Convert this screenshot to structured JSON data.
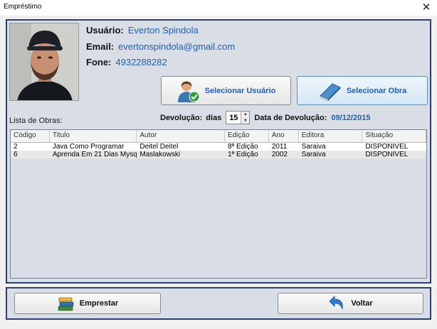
{
  "window": {
    "title": "Empréstimo",
    "close_glyph": "✕"
  },
  "user": {
    "usuario_label": "Usuário:",
    "usuario_value": "Everton Spindola",
    "email_label": "Email:",
    "email_value": "evertonspindola@gmail.com",
    "fone_label": "Fone:",
    "fone_value": "4932288282"
  },
  "buttons": {
    "selecionar_usuario": "Selecionar Usuário",
    "selecionar_obra": "Selecionar Obra",
    "emprestar": "Emprestar",
    "voltar": "Voltar"
  },
  "lista_label": "Lista de Obras:",
  "devolucao": {
    "label": "Devolução:",
    "dias_label": "dias",
    "dias_value": "15",
    "data_label": "Data de Devolução:",
    "data_value": "09/12/2015"
  },
  "table": {
    "columns": [
      "Código",
      "Titulo",
      "Autor",
      "Edição",
      "Ano",
      "Editora",
      "Situação"
    ],
    "rows": [
      [
        "2",
        "Java Como Programar",
        "Deitel Deitel",
        "8ª Edição",
        "2011",
        "Saraiva",
        "DISPONIVEL"
      ],
      [
        "6",
        "Aprenda Em 21 Dias Mysql",
        "Maslakowski",
        "1ª Edição",
        "2002",
        "Saraiva",
        "DISPONIVEL"
      ]
    ]
  },
  "icons": {
    "close": "close-icon",
    "user_select": "user-check-icon",
    "book_select": "book-icon",
    "books_lend": "books-stack-icon",
    "back": "back-arrow-icon"
  },
  "colors": {
    "accent": "#1f5fb3",
    "panel": "#d9dde6",
    "border": "#2d3e6a"
  }
}
